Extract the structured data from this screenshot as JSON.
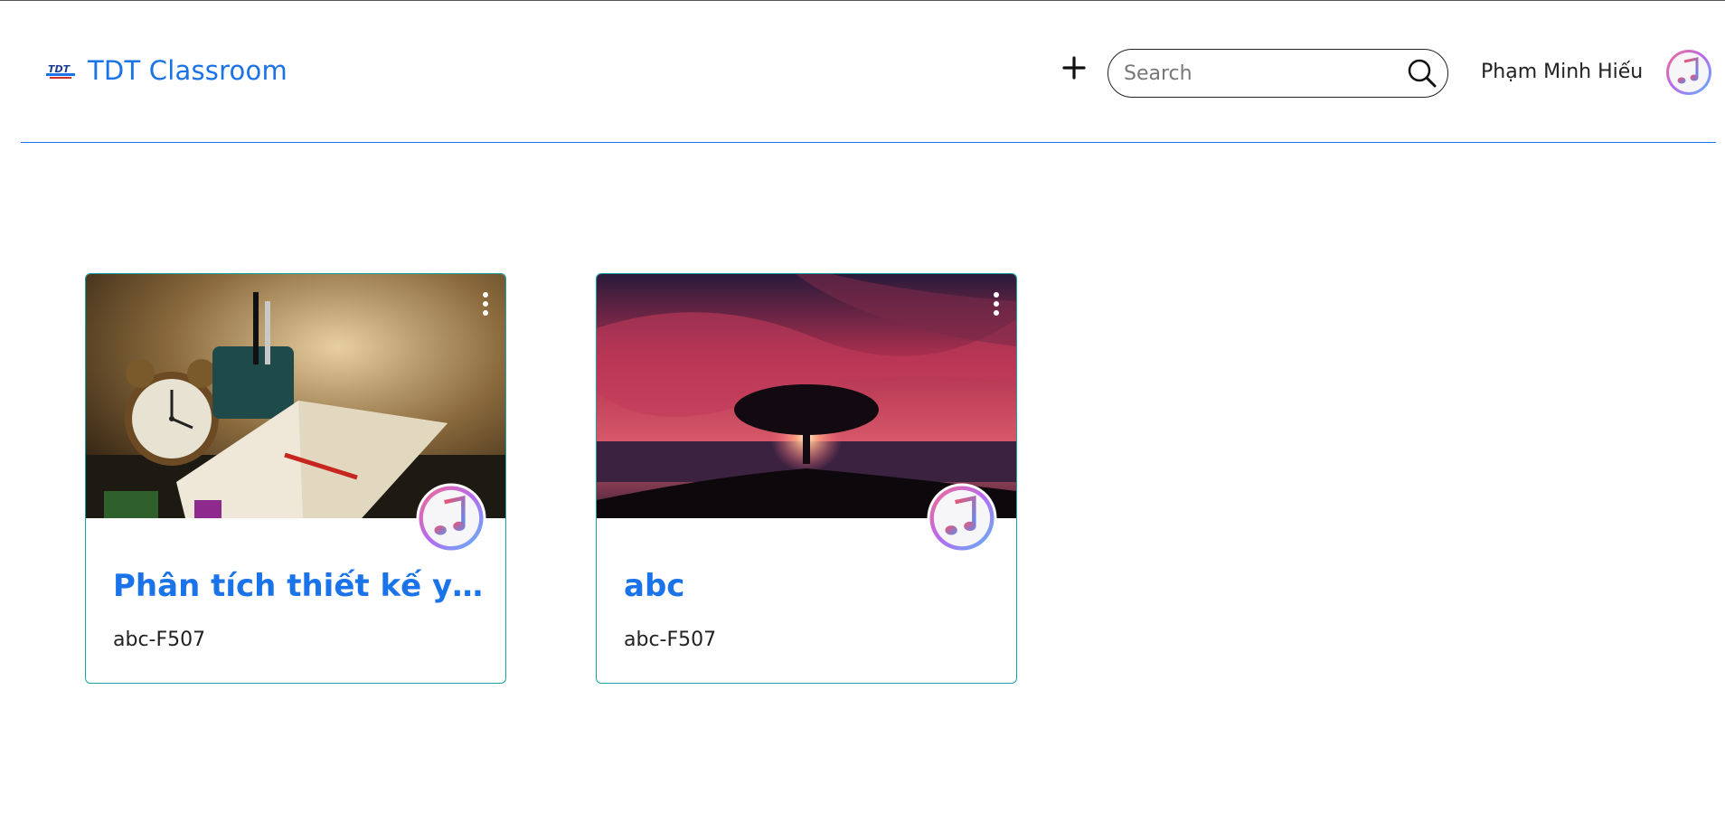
{
  "header": {
    "brand_name": "TDT Classroom",
    "brand_logo_text": "TDT",
    "search_placeholder": "Search",
    "search_value": "",
    "user_name": "Phạm Minh Hiếu"
  },
  "icons": {
    "add": "plus-icon",
    "search": "search-icon",
    "avatar": "music-note-icon",
    "menu": "kebab-menu-icon"
  },
  "colors": {
    "brand_blue": "#1a73e8",
    "card_border": "#18a3a0",
    "header_divider": "#1a73e8"
  },
  "classes": [
    {
      "title": "Phân tích thiết kế yêu ...",
      "code": "abc-F507"
    },
    {
      "title": "abc",
      "code": "abc-F507"
    }
  ]
}
